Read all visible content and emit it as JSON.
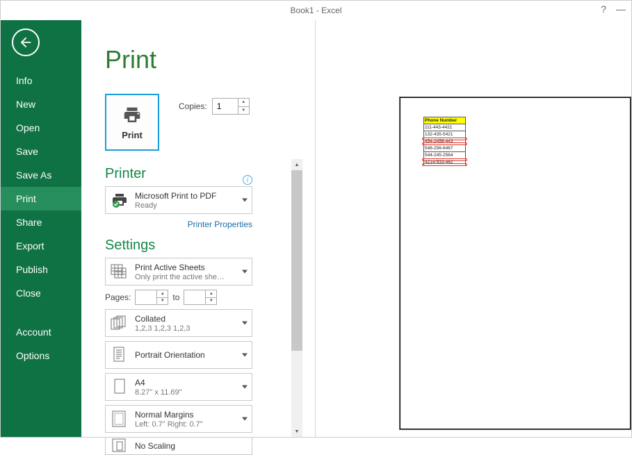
{
  "title_bar": "Book1 - Excel",
  "sidebar": {
    "items": [
      "Info",
      "New",
      "Open",
      "Save",
      "Save As",
      "Print",
      "Share",
      "Export",
      "Publish",
      "Close"
    ],
    "selected": "Print",
    "footer": [
      "Account",
      "Options"
    ]
  },
  "page": {
    "title": "Print",
    "print_button": "Print",
    "copies_label": "Copies:",
    "copies_value": "1"
  },
  "printer": {
    "heading": "Printer",
    "name": "Microsoft Print to PDF",
    "status": "Ready",
    "props_link": "Printer Properties"
  },
  "settings": {
    "heading": "Settings",
    "scope": {
      "primary": "Print Active Sheets",
      "secondary": "Only print the active she…"
    },
    "pages": {
      "label": "Pages:",
      "to": "to"
    },
    "collate": {
      "primary": "Collated",
      "secondary": "1,2,3    1,2,3    1,2,3"
    },
    "orientation": {
      "primary": "Portrait Orientation"
    },
    "paper": {
      "primary": "A4",
      "secondary": "8.27\" x 11.69\""
    },
    "margins": {
      "primary": "Normal Margins",
      "secondary": "Left:  0.7\"    Right:  0.7\""
    },
    "scaling": {
      "primary": "No Scaling"
    }
  },
  "preview": {
    "header": "Phone Number",
    "rows": [
      {
        "t": "111-443-4421",
        "mark": false
      },
      {
        "t": "132-435-5421",
        "mark": false
      },
      {
        "t": "454-2456-443",
        "mark": true
      },
      {
        "t": "546-256-6467",
        "mark": false
      },
      {
        "t": "544-245-2564",
        "mark": false
      },
      {
        "t": "4214-533-462",
        "mark": true
      }
    ]
  }
}
